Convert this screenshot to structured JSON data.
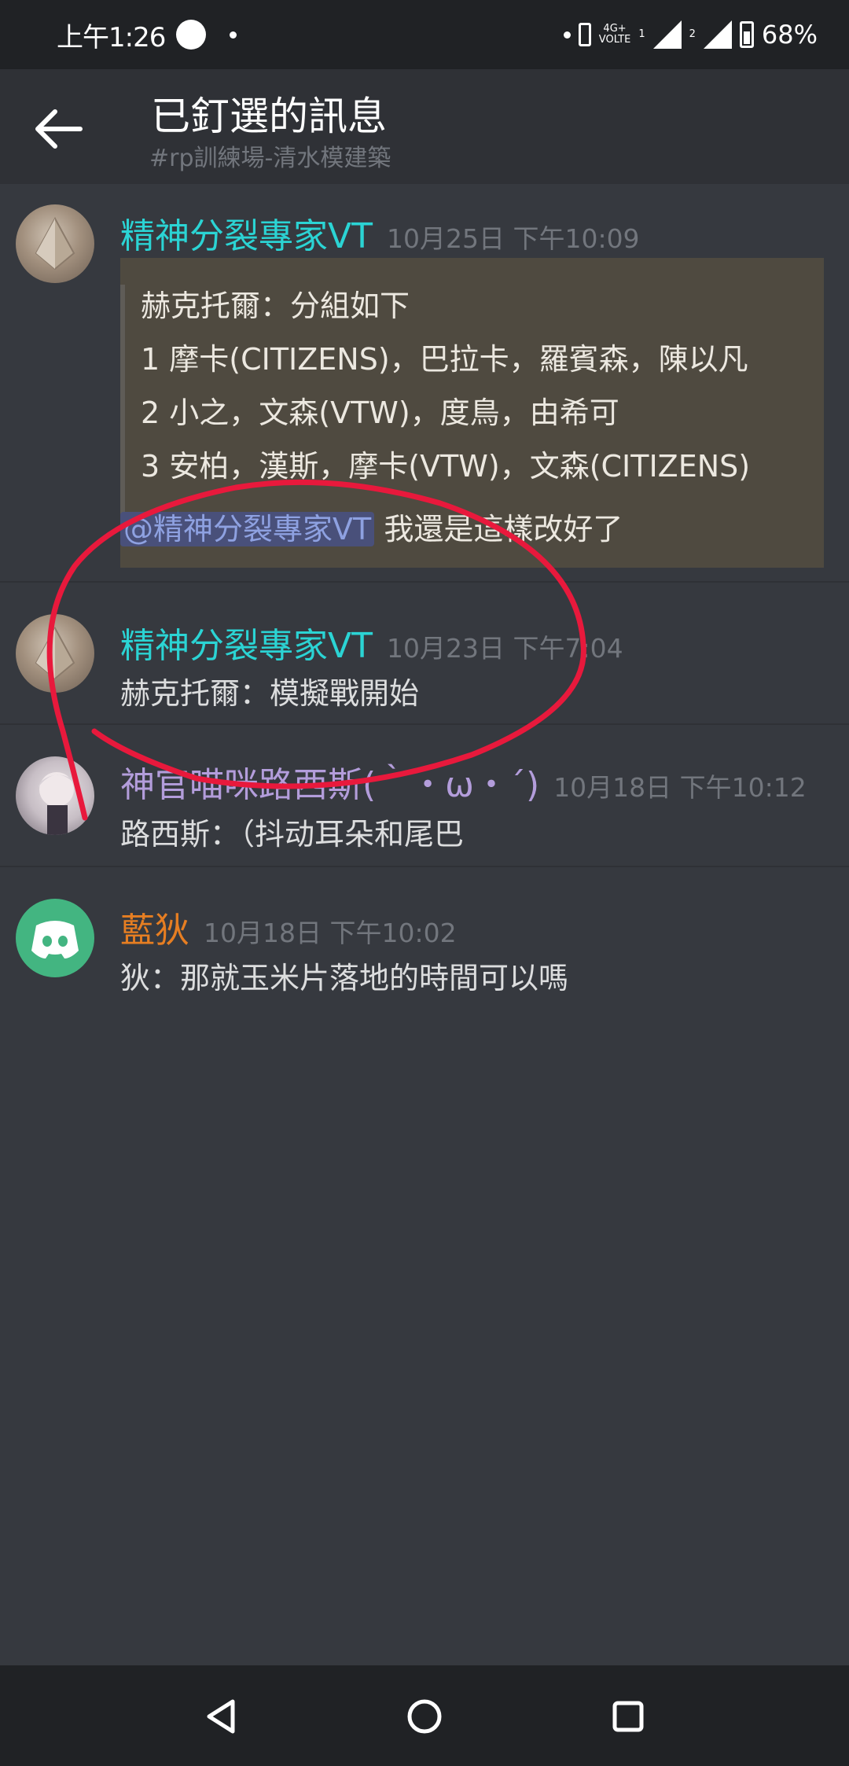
{
  "status_bar": {
    "time": "上午1:26",
    "network": "4G+",
    "volte": "VOLTE",
    "sim1": "1",
    "sim2": "2",
    "battery": "68%"
  },
  "header": {
    "title": "已釘選的訊息",
    "subtitle": "#rp訓練場-清水模建築"
  },
  "messages": [
    {
      "username": "精神分裂專家VT",
      "timestamp": "10月25日 下午10:09",
      "name_color": "#2bd4d4",
      "embed_lines": [
        "赫克托爾：分組如下",
        "1 摩卡(CITIZENS)，巴拉卡，羅賓森，陳以凡",
        "2 小之，文森(VTW)，度鳥，由希可",
        "3 安柏，漢斯，摩卡(VTW)，文森(CITIZENS)"
      ],
      "mention": "@精神分裂專家VT",
      "text": "我還是這樣改好了"
    },
    {
      "username": "精神分裂專家VT",
      "timestamp": "10月23日 下午7:04",
      "name_color": "#2bd4d4",
      "text": "赫克托爾：模擬戰開始"
    },
    {
      "username": "神官喵咪路西斯(｀・ω・´)",
      "timestamp": "10月18日 下午10:12",
      "name_color": "#b39ddb",
      "text": "路西斯：（抖动耳朵和尾巴"
    },
    {
      "username": "藍狄",
      "timestamp": "10月18日 下午10:02",
      "name_color": "#e67e22",
      "text": "狄：那就玉米片落地的時間可以嗎"
    }
  ],
  "icons": {
    "back": "arrow-left-icon",
    "nav_back": "triangle-back-icon",
    "nav_home": "circle-home-icon",
    "nav_recents": "square-recents-icon",
    "annotation": "red-hand-drawn-circle"
  },
  "colors": {
    "background": "#36393f",
    "header": "#2f3136",
    "annotation": "#e8193c"
  }
}
